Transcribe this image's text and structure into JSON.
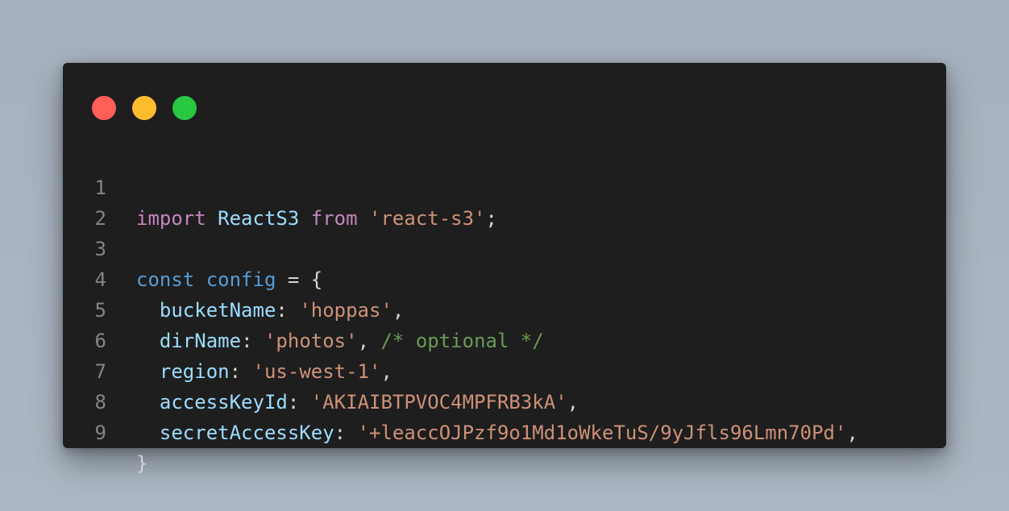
{
  "window_controls": {
    "close_color": "#ff5f57",
    "minimize_color": "#febc2e",
    "maximize_color": "#28c840"
  },
  "code": {
    "line_numbers": [
      "1",
      "2",
      "3",
      "4",
      "5",
      "6",
      "7",
      "8",
      "9"
    ],
    "line1": {
      "import_kw": "import",
      "ident": "ReactS3",
      "from_kw": "from",
      "module": "'react-s3'",
      "semicolon": ";"
    },
    "line3": {
      "const_kw": "const",
      "ident": "config",
      "assign": " = {"
    },
    "line4": {
      "key": "bucketName",
      "colon": ":",
      "value": "'hoppas'",
      "comma": ","
    },
    "line5": {
      "key": "dirName",
      "colon": ":",
      "value": "'photos'",
      "comma": ",",
      "comment": "/* optional */"
    },
    "line6": {
      "key": "region",
      "colon": ":",
      "value": "'us-west-1'",
      "comma": ","
    },
    "line7": {
      "key": "accessKeyId",
      "colon": ":",
      "value": "'AKIAIBTPVOC4MPFRB3kA'",
      "comma": ","
    },
    "line8": {
      "key": "secretAccessKey",
      "colon": ":",
      "value": "'+leaccOJPzf9o1Md1oWkeTuS/9yJfls96Lmn70Pd'",
      "comma": ","
    },
    "line9": {
      "close_brace": "}"
    }
  },
  "colors": {
    "background": "#a9b5c1",
    "editor_background": "#1e1e1e",
    "keyword": "#c586c0",
    "declaration": "#569cd6",
    "variable": "#9cdcfe",
    "string": "#ce9178",
    "comment": "#6a9955",
    "line_number": "#858585"
  }
}
